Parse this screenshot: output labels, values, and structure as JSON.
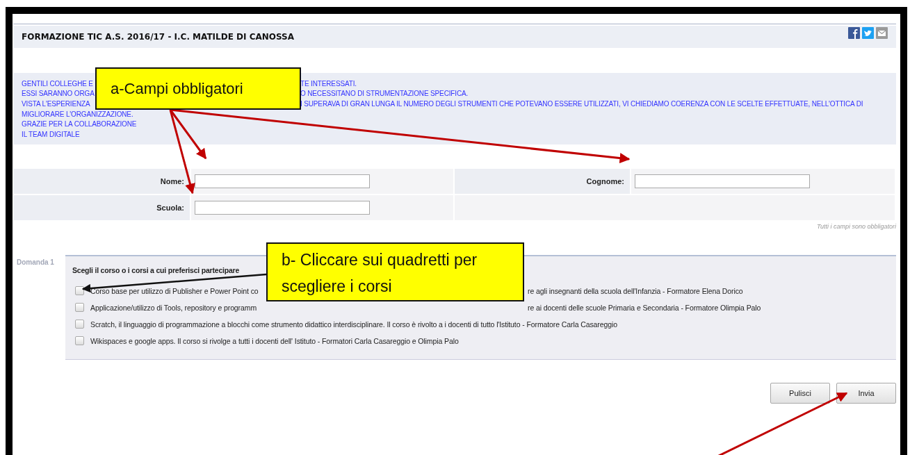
{
  "header": {
    "title": "FORMAZIONE TIC A.S. 2016/17 - I.C. MATILDE DI CANOSSA"
  },
  "intro": [
    {
      "fragments": [
        "GENTILI COLLEGHE E",
        "TE INTERESSATI."
      ]
    },
    {
      "fragments": [
        "ESSI SARANNO ORGA",
        "O NECESSITANO DI STRUMENTAZIONE SPECIFICA."
      ]
    },
    {
      "fragments": [
        "VISTA L'ESPERIENZA",
        "I SUPERAVA DI GRAN LUNGA IL NUMERO DEGLI STRUMENTI CHE POTEVANO ESSERE UTILIZZATI, VI CHIEDIAMO COERENZA CON LE SCELTE EFFETTUATE, NELL'OTTICA DI"
      ]
    },
    {
      "fragments": [
        "MIGLIORARE L'ORGANIZZAZIONE."
      ]
    },
    {
      "fragments": [
        "GRAZIE PER LA COLLABORAZIONE"
      ]
    },
    {
      "fragments": [
        "IL TEAM DIGITALE"
      ]
    }
  ],
  "fields": [
    {
      "label": "Nome:"
    },
    {
      "label": "Cognome:"
    },
    {
      "label": "Scuola:"
    }
  ],
  "required_note": "Tutti i campi sono obbligatori",
  "question": {
    "number": "Domanda 1",
    "title": "Scegli il corso o i corsi a cui preferisci partecipare",
    "options": [
      {
        "fragments": [
          "Corso base per utilizzo di Publisher e Power Point co",
          "re agli insegnanti della scuola dell'Infanzia - Formatore Elena Dorico"
        ],
        "checked": false
      },
      {
        "fragments": [
          "Applicazione/utilizzo di Tools, repository e programm",
          "re ai docenti delle scuole Primaria e Secondaria - Formatore Olimpia Palo"
        ],
        "checked": false
      },
      {
        "fragments": [
          "Scratch, il linguaggio di programmazione a blocchi come strumento didattico interdisciplinare. Il corso è rivolto a i docenti di tutto l'Istituto - Formatore Carla Casareggio"
        ],
        "checked": false
      },
      {
        "fragments": [
          "Wikispaces e google apps. Il corso si rivolge a tutti i docenti dell' Istituto - Formatori Carla Casareggio e Olimpia Palo"
        ],
        "checked": false
      }
    ]
  },
  "buttons": [
    "Pulisci",
    "Invia"
  ],
  "annotations": [
    {
      "text": "a-Campi obbligatori"
    },
    {
      "text": "b- Cliccare sui quadretti per scegliere i corsi"
    }
  ]
}
